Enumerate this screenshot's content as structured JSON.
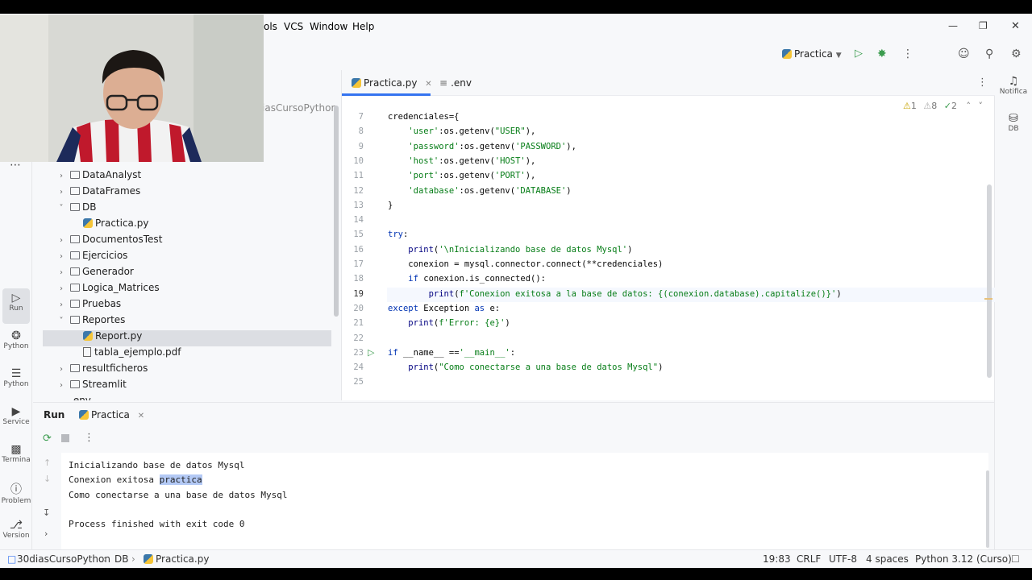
{
  "menu": [
    "ols",
    "VCS",
    "Window",
    "Help"
  ],
  "toolbar": {
    "run_config": "Practica"
  },
  "left_stripe": [
    {
      "icon": "run-icon",
      "label": "Run"
    },
    {
      "icon": "python-icon",
      "label": "Python"
    },
    {
      "icon": "layers-icon",
      "label": "Python"
    },
    {
      "icon": "services-icon",
      "label": "Service"
    },
    {
      "icon": "terminal-icon",
      "label": "Termina"
    },
    {
      "icon": "problems-icon",
      "label": "Problem"
    },
    {
      "icon": "git-icon",
      "label": "Version"
    }
  ],
  "right_stripe": [
    {
      "icon": "notifications-icon",
      "label": "Notifica"
    },
    {
      "icon": "database-icon",
      "label": "DB"
    }
  ],
  "project": {
    "root_fragment": "iasCursoPython",
    "tree": [
      {
        "label": "DataAnalyst",
        "kind": "folder",
        "depth": 0,
        "expanded": false
      },
      {
        "label": "DataFrames",
        "kind": "folder",
        "depth": 0,
        "expanded": false
      },
      {
        "label": "DB",
        "kind": "folder",
        "depth": 0,
        "expanded": true
      },
      {
        "label": "Practica.py",
        "kind": "py",
        "depth": 1
      },
      {
        "label": "DocumentosTest",
        "kind": "folder",
        "depth": 0,
        "expanded": false
      },
      {
        "label": "Ejercicios",
        "kind": "folder",
        "depth": 0,
        "expanded": false
      },
      {
        "label": "Generador",
        "kind": "folder",
        "depth": 0,
        "expanded": false
      },
      {
        "label": "Logica_Matrices",
        "kind": "folder",
        "depth": 0,
        "expanded": false
      },
      {
        "label": "Pruebas",
        "kind": "folder",
        "depth": 0,
        "expanded": false
      },
      {
        "label": "Reportes",
        "kind": "folder",
        "depth": 0,
        "expanded": true
      },
      {
        "label": "Report.py",
        "kind": "py",
        "depth": 1,
        "selected": true
      },
      {
        "label": "tabla_ejemplo.pdf",
        "kind": "pdf",
        "depth": 1
      },
      {
        "label": "resultficheros",
        "kind": "folder",
        "depth": 0,
        "expanded": false
      },
      {
        "label": "Streamlit",
        "kind": "folder",
        "depth": 0,
        "expanded": false
      },
      {
        "label": ".env",
        "kind": "file",
        "depth": 0
      }
    ]
  },
  "editor": {
    "tabs": [
      {
        "label": "Practica.py",
        "active": true
      },
      {
        "label": ".env",
        "active": false
      }
    ],
    "indicators": {
      "warnings": "1",
      "weak_warnings": "8",
      "ok": "2"
    },
    "line_numbers": [
      "7",
      "8",
      "9",
      "10",
      "11",
      "12",
      "13",
      "14",
      "15",
      "16",
      "17",
      "18",
      "19",
      "20",
      "21",
      "22",
      "23",
      "24",
      "25"
    ],
    "current_line": "19",
    "lines": [
      "credenciales={",
      "    'user':os.getenv(\"USER\"),",
      "    'password':os.getenv('PASSWORD'),",
      "    'host':os.getenv('HOST'),",
      "    'port':os.getenv('PORT'),",
      "    'database':os.getenv('DATABASE')",
      "}",
      "",
      "try:",
      "    print('\\nInicializando base de datos Mysql')",
      "    conexion = mysql.connector.connect(**credenciales)",
      "    if conexion.is_connected():",
      "        print(f'Conexion exitosa a la base de datos: {(conexion.database).capitalize()}')",
      "except Exception as e:",
      "    print(f'Error: {e}')",
      "",
      "if __name__ =='__main__':",
      "    print(\"Como conectarse a una base de datos Mysql\")",
      ""
    ]
  },
  "run_panel": {
    "tabs": [
      {
        "label": "Run"
      },
      {
        "label": "Practica"
      }
    ],
    "output": [
      "Inicializando base de datos Mysql",
      "Conexion exitosa ",
      "practica",
      "Como conectarse a una base de datos Mysql",
      "",
      "Process finished with exit code 0"
    ]
  },
  "statusbar": {
    "breadcrumb": [
      "30diasCursoPython",
      "DB",
      "Practica.py"
    ],
    "position": "19:83",
    "line_sep": "CRLF",
    "encoding": "UTF-8",
    "indent": "4 spaces",
    "interpreter": "Python 3.12 (Curso)"
  },
  "colors": {
    "accent": "#3574f0",
    "run_green": "#3b9c4e",
    "keyword": "#0033b3",
    "string": "#067d17"
  }
}
